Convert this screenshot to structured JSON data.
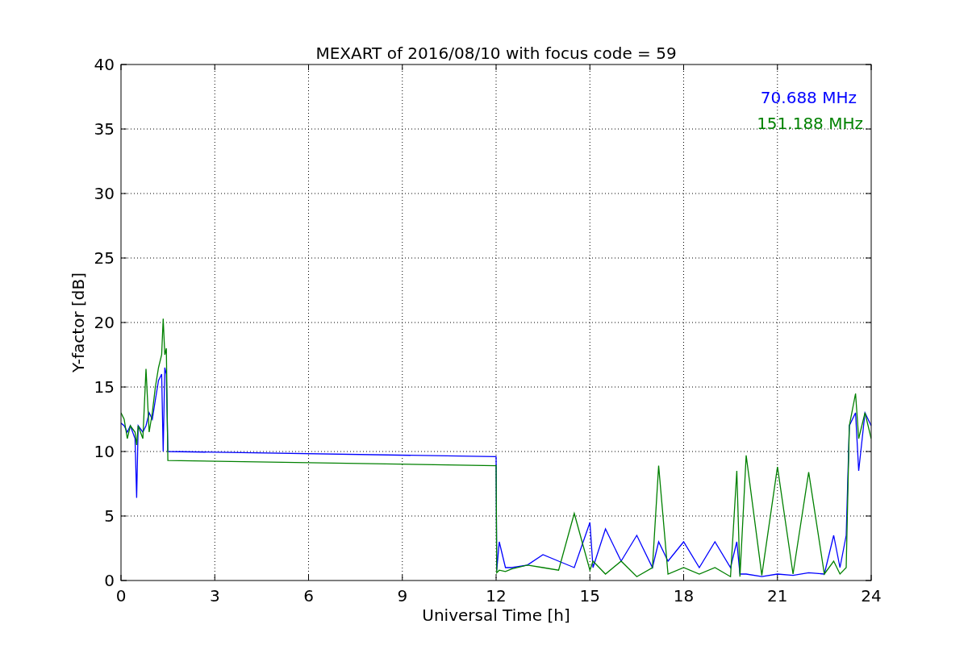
{
  "chart_data": {
    "type": "line",
    "title": "MEXART of 2016/08/10 with focus code = 59",
    "xlabel": "Universal Time [h]",
    "ylabel": "Y-factor [dB]",
    "x": [
      0,
      0.1,
      0.2,
      0.3,
      0.45,
      0.5,
      0.55,
      0.7,
      0.8,
      0.9,
      1.0,
      1.1,
      1.2,
      1.3,
      1.35,
      1.4,
      1.45,
      1.5,
      12.0,
      12.02,
      12.1,
      12.3,
      12.5,
      13.0,
      13.5,
      14.0,
      14.5,
      15.0,
      15.1,
      15.5,
      16,
      16.5,
      17,
      17.2,
      17.5,
      18,
      18.5,
      19,
      19.5,
      19.7,
      19.8,
      20,
      20.5,
      21,
      21.5,
      22,
      22.5,
      22.8,
      23,
      23.2,
      23.3,
      23.5,
      23.6,
      23.8,
      24
    ],
    "series": [
      {
        "name": "70.688 MHz",
        "color": "#0000ff",
        "values": [
          12.2,
          12,
          11.5,
          12,
          11,
          6.4,
          12,
          11.5,
          12,
          13,
          12.5,
          14,
          15.5,
          16,
          10,
          16.5,
          16,
          10,
          9.6,
          0.8,
          3,
          1,
          1,
          1.2,
          2,
          1.5,
          1,
          4.5,
          1,
          4,
          1.5,
          3.5,
          1,
          3,
          1.5,
          3,
          1,
          3,
          1,
          3,
          0.5,
          0.5,
          0.3,
          0.5,
          0.4,
          0.6,
          0.5,
          3.5,
          1,
          3.5,
          12,
          13,
          8.5,
          13,
          12
        ]
      },
      {
        "name": "151.188 MHz",
        "color": "#008000",
        "values": [
          13,
          12.5,
          11,
          12,
          11.5,
          10.5,
          12,
          11,
          16.4,
          11.5,
          13,
          15,
          16.5,
          17.5,
          20.3,
          17.5,
          18,
          9.3,
          8.9,
          0.6,
          0.8,
          0.7,
          0.9,
          1.2,
          1,
          0.8,
          5.2,
          0.8,
          1.5,
          0.5,
          1.5,
          0.3,
          1,
          8.9,
          0.5,
          1,
          0.5,
          1,
          0.3,
          8.5,
          0.3,
          9.7,
          0.4,
          8.8,
          0.5,
          8.4,
          0.5,
          1.5,
          0.5,
          1,
          12,
          14.5,
          11,
          13,
          11
        ]
      }
    ],
    "grid": true,
    "xlim": [
      0,
      24
    ],
    "ylim": [
      0,
      40
    ],
    "xticks": [
      0,
      3,
      6,
      9,
      12,
      15,
      18,
      21,
      24
    ],
    "yticks": [
      0,
      5,
      10,
      15,
      20,
      25,
      30,
      35,
      40
    ]
  }
}
